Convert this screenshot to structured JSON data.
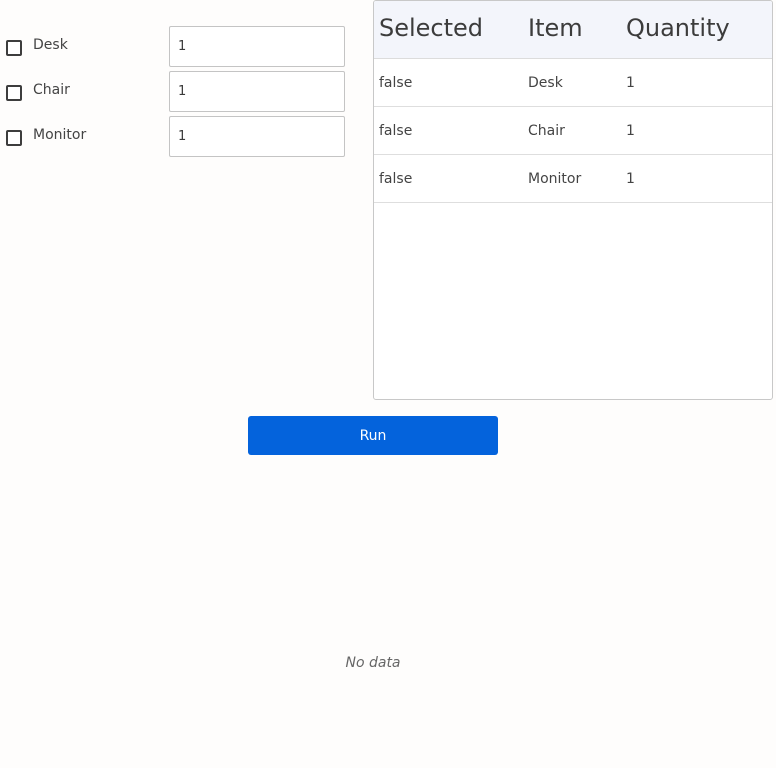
{
  "form": {
    "rows": [
      {
        "label": "Desk",
        "checked": false,
        "quantity": "1"
      },
      {
        "label": "Chair",
        "checked": false,
        "quantity": "1"
      },
      {
        "label": "Monitor",
        "checked": false,
        "quantity": "1"
      }
    ]
  },
  "table": {
    "headers": [
      "Selected",
      "Item",
      "Quantity"
    ],
    "rows": [
      [
        "false",
        "Desk",
        "1"
      ],
      [
        "false",
        "Chair",
        "1"
      ],
      [
        "false",
        "Monitor",
        "1"
      ]
    ]
  },
  "actions": {
    "run_label": "Run"
  },
  "output": {
    "empty_text": "No data"
  },
  "colors": {
    "accent": "#0463dc",
    "table_header_bg": "#f3f5fb"
  },
  "icons": {
    "checkbox": "checkbox-unchecked-icon"
  }
}
